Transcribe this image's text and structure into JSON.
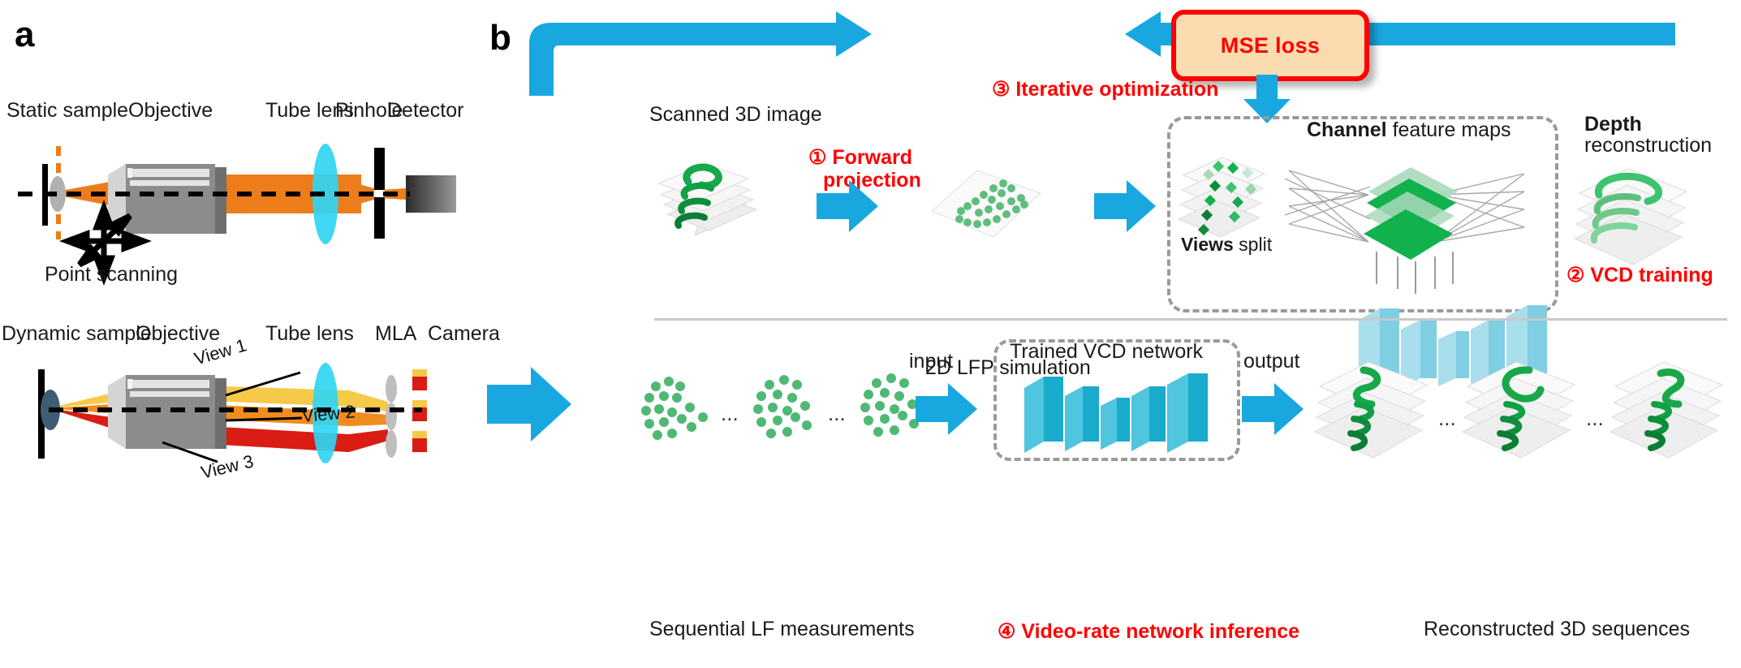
{
  "figure": {
    "panels": [
      {
        "id": "a",
        "letter": "a"
      },
      {
        "id": "b",
        "letter": "b"
      }
    ]
  },
  "panel_a": {
    "letter": "a",
    "top_row": {
      "labels": [
        "Static sample",
        "Objective",
        "Tube lens",
        "Pinhole",
        "Detector"
      ],
      "annotation": "Point scanning"
    },
    "bottom_row": {
      "labels": [
        "Dynamic sample",
        "Objective",
        "Tube lens",
        "MLA",
        "Camera"
      ],
      "view_labels": [
        "View 1",
        "View 2",
        "View 3"
      ]
    }
  },
  "panel_b": {
    "letter": "b",
    "loss_box": "MSE loss",
    "steps": [
      {
        "num": "①",
        "text": "Forward\nprojection"
      },
      {
        "num": "②",
        "text": "VCD training"
      },
      {
        "num": "③",
        "text": "Iterative optimization"
      },
      {
        "num": "④",
        "text": "Video-rate network inference"
      }
    ],
    "step1_line1": "① Forward",
    "step1_line2": "projection",
    "step2": "② VCD training",
    "step3": "③ Iterative optimization",
    "step4": "④ Video-rate network inference",
    "training_row": {
      "scanned_label": "Scanned 3D image",
      "lfp_label": "2D LFP simulation",
      "views_split_bold": "Views",
      "views_split_rest": " split",
      "channel_bold": "Channel",
      "channel_rest": " feature maps",
      "depth_bold": "Depth",
      "depth_rest": "reconstruction"
    },
    "inference_row": {
      "sequential_label": "Sequential LF measurements",
      "input_label": "input",
      "output_label": "output",
      "network_label": "Trained VCD network",
      "reconstructed_label": "Reconstructed 3D sequences",
      "ellipsis": "..."
    }
  },
  "colors": {
    "arrow_blue": "#19A7E0",
    "loss_red": "#ff0000",
    "loss_fill": "#fbdcb0",
    "lens_cyan": "#30D5F2",
    "excitation_orange": "#ED7D1B",
    "objective_gray": "#8C8C8C",
    "worm_green": "#17A84A",
    "feature_green_dark": "#11B14E",
    "feature_green_light": "#A9D9BA",
    "conv_blue": "#1AAFD0",
    "conv_blue_light": "#A9DEEC",
    "dash_gray": "#9a9a9a",
    "view1_yellow": "#F7C948",
    "view2_orange": "#F08C1E",
    "view3_red": "#D91D14"
  }
}
